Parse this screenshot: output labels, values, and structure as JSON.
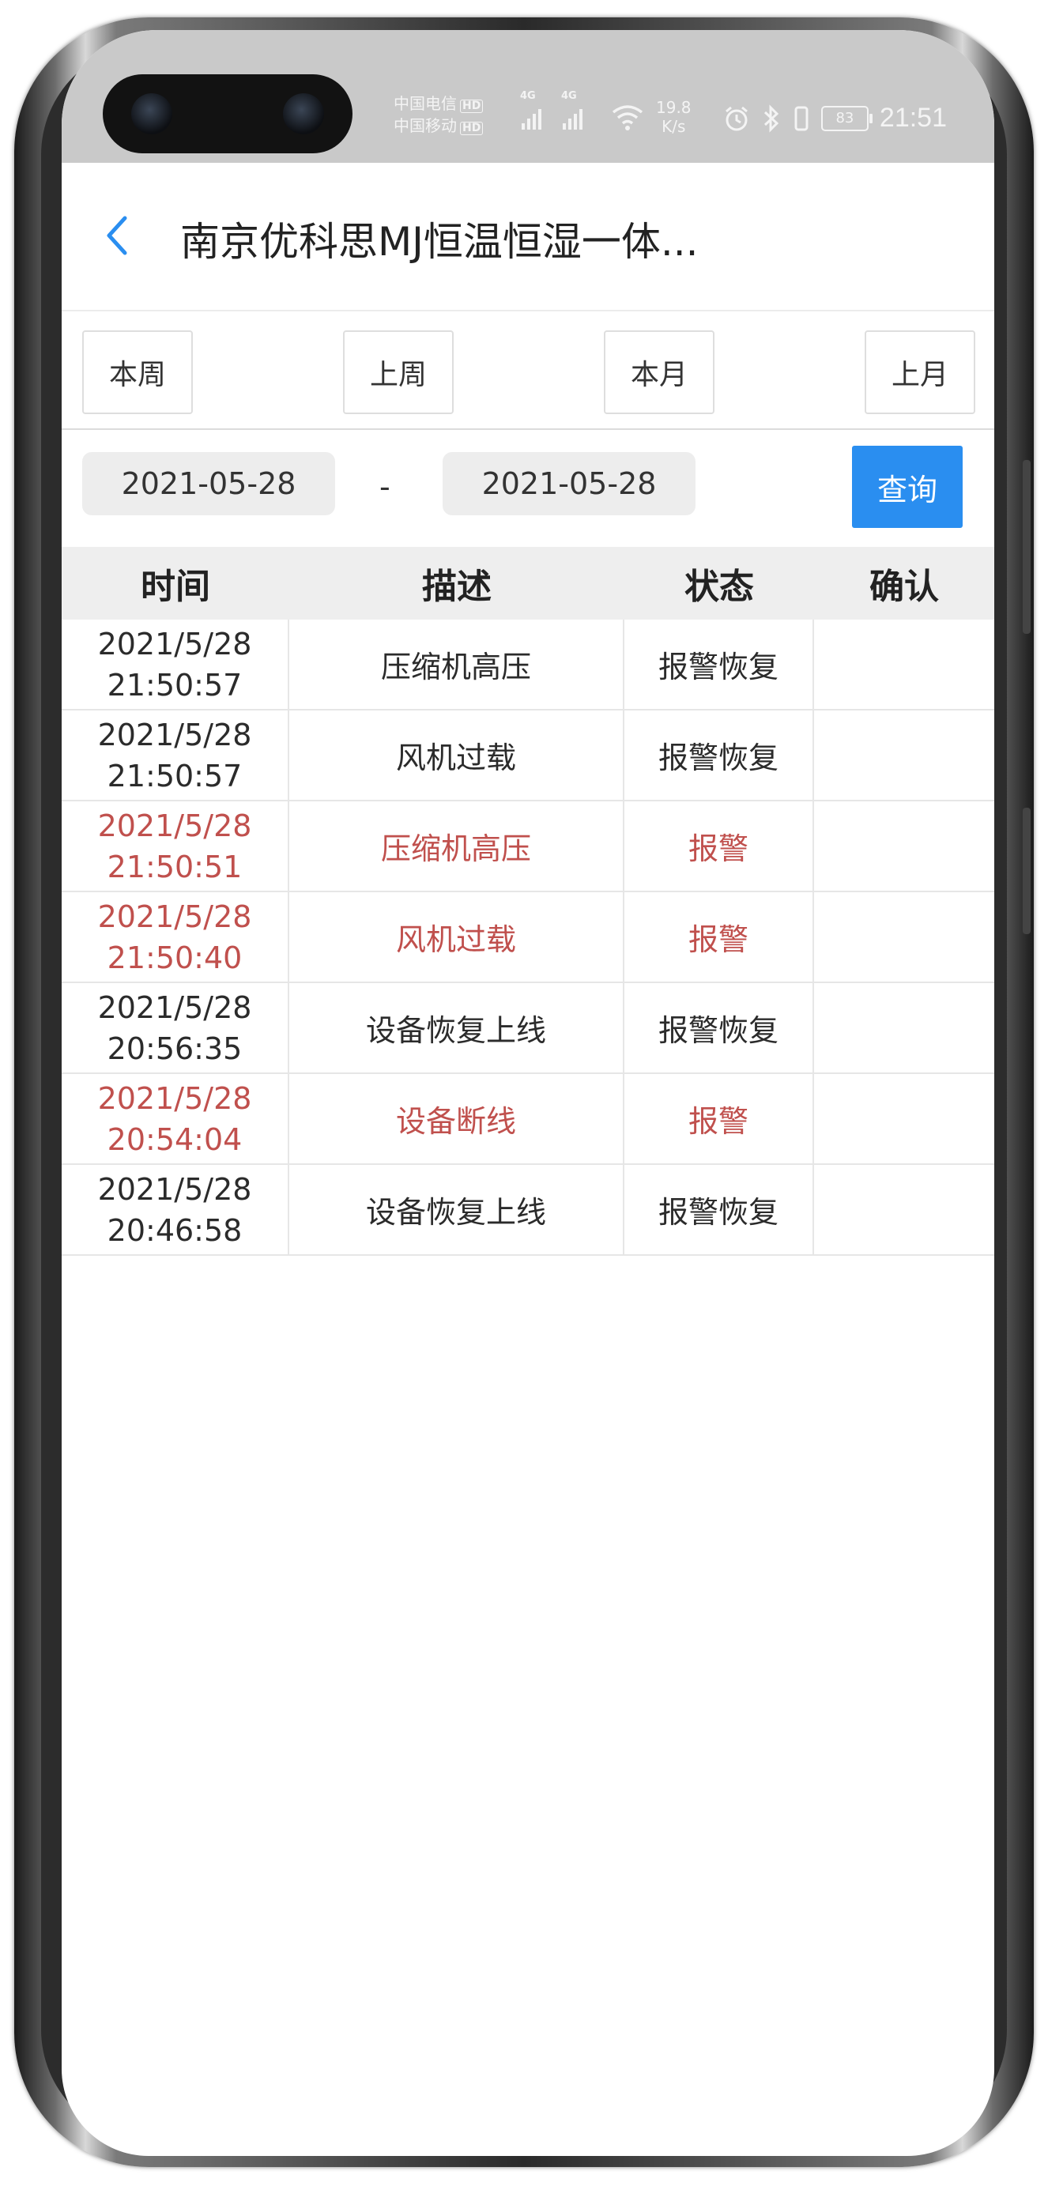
{
  "status_bar": {
    "carrier1": "中国电信",
    "carrier2": "中国移动",
    "hd": "HD",
    "net1": "4G",
    "net2": "4G",
    "speed_value": "19.8",
    "speed_unit": "K/s",
    "battery": "83",
    "time": "21:51",
    "icons": [
      "wifi-icon",
      "alarm-clock-icon",
      "bluetooth-icon",
      "vibrate-icon",
      "battery-icon"
    ]
  },
  "header": {
    "title": "南京优科思MJ恒温恒湿一体...",
    "back_icon": "chevron-left-icon",
    "accent_color": "#2a8ef0"
  },
  "quick_ranges": [
    "本周",
    "上周",
    "本月",
    "上月"
  ],
  "date_filter": {
    "start": "2021-05-28",
    "separator": "-",
    "end": "2021-05-28",
    "query_label": "查询"
  },
  "table": {
    "columns": [
      "时间",
      "描述",
      "状态",
      "确认"
    ],
    "alarm_color": "#c0504d",
    "rows": [
      {
        "date": "2021/5/28",
        "time": "21:50:57",
        "desc": "压缩机高压",
        "status": "报警恢复",
        "confirm": "",
        "alarm": false
      },
      {
        "date": "2021/5/28",
        "time": "21:50:57",
        "desc": "风机过载",
        "status": "报警恢复",
        "confirm": "",
        "alarm": false
      },
      {
        "date": "2021/5/28",
        "time": "21:50:51",
        "desc": "压缩机高压",
        "status": "报警",
        "confirm": "",
        "alarm": true
      },
      {
        "date": "2021/5/28",
        "time": "21:50:40",
        "desc": "风机过载",
        "status": "报警",
        "confirm": "",
        "alarm": true
      },
      {
        "date": "2021/5/28",
        "time": "20:56:35",
        "desc": "设备恢复上线",
        "status": "报警恢复",
        "confirm": "",
        "alarm": false
      },
      {
        "date": "2021/5/28",
        "time": "20:54:04",
        "desc": "设备断线",
        "status": "报警",
        "confirm": "",
        "alarm": true
      },
      {
        "date": "2021/5/28",
        "time": "20:46:58",
        "desc": "设备恢复上线",
        "status": "报警恢复",
        "confirm": "",
        "alarm": false
      }
    ]
  }
}
